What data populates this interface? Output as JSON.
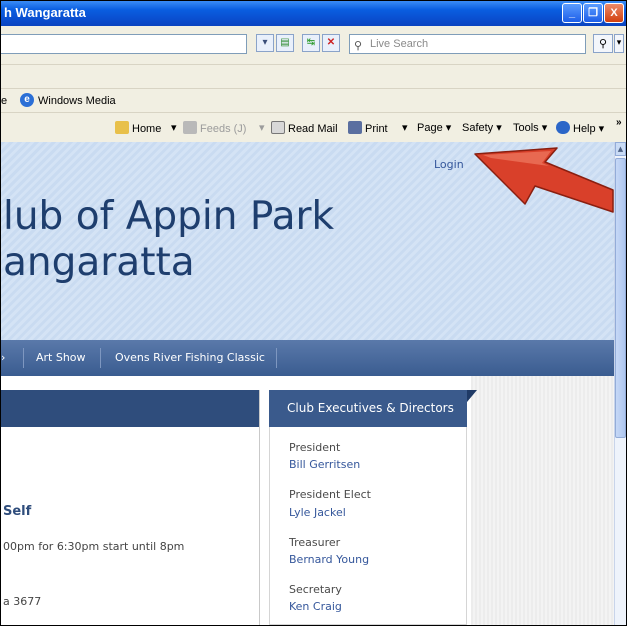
{
  "window": {
    "title": "h Wangaratta",
    "buttons": {
      "minimize": "_",
      "maximize": "❐",
      "close": "X"
    }
  },
  "address_bar": {
    "search_placeholder": "Live Search",
    "search_icon": "magnifier-icon"
  },
  "links_bar": {
    "truncated_link": "e",
    "windows_media": "Windows Media"
  },
  "command_bar": {
    "home": "Home",
    "feeds": "Feeds (J)",
    "read_mail": "Read Mail",
    "print": "Print",
    "page": "Page",
    "safety": "Safety",
    "tools": "Tools",
    "help": "Help",
    "chevron": "»"
  },
  "site": {
    "login": "Login",
    "title_line1": "lub of Appin Park",
    "title_line2": "angaratta",
    "nav": {
      "items": [
        "Art Show",
        "Ovens River Fishing Classic"
      ]
    },
    "main": {
      "event_title": "Self",
      "event_time": "00pm for 6:30pm start until 8pm",
      "event_address": "a  3677"
    },
    "sidebar": {
      "heading": "Club Executives & Directors",
      "executives": [
        {
          "role": "President",
          "name": "Bill Gerritsen"
        },
        {
          "role": "President Elect",
          "name": "Lyle Jackel"
        },
        {
          "role": "Treasurer",
          "name": "Bernard Young"
        },
        {
          "role": "Secretary",
          "name": "Ken Craig"
        }
      ]
    }
  },
  "colors": {
    "accent_arrow": "#d9402a",
    "nav_bar": "#3a5c90",
    "heading_text": "#1e3e6e",
    "link": "#35579b"
  }
}
